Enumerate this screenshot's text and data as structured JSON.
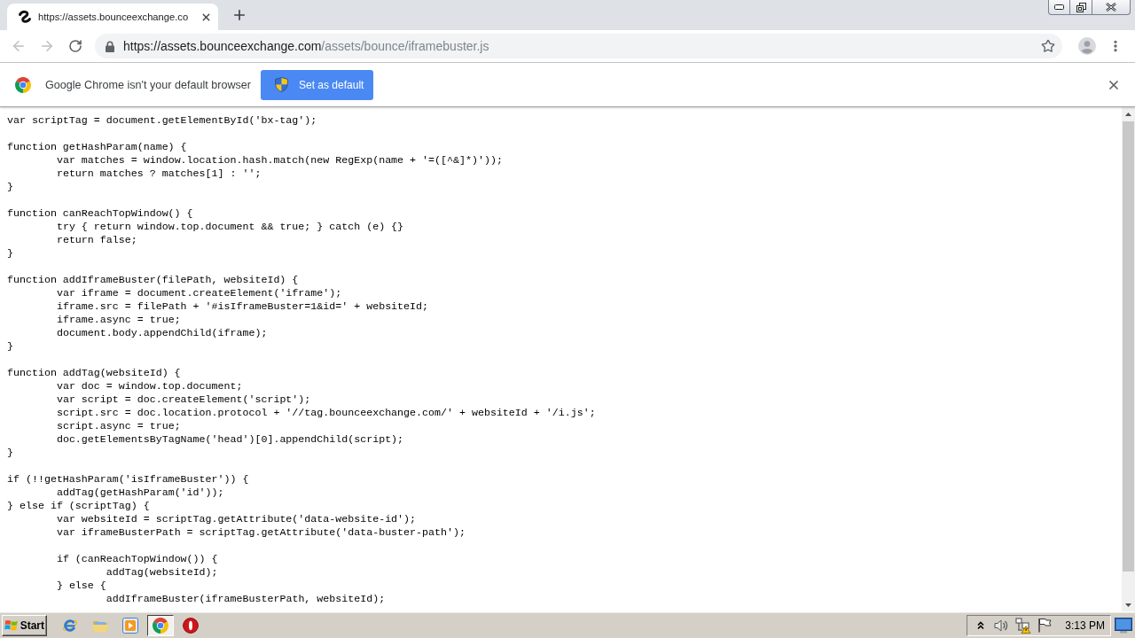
{
  "browser": {
    "tabs": [
      {
        "title": "https://assets.bounceexchange.co",
        "selected": true
      }
    ],
    "toolbar": {
      "back": {
        "disabled": true
      },
      "forward": {
        "disabled": true
      },
      "address": {
        "host": "https://assets.bounceexchange.com",
        "path": "/assets/bounce/iframebuster.js"
      }
    }
  },
  "infobar": {
    "message": "Google Chrome isn't your default browser",
    "button": "Set as default"
  },
  "code_blocks": [
    [
      "var scriptTag = document.getElementById('bx-tag');"
    ],
    [
      "function getHashParam(name) {",
      "\tvar matches = window.location.hash.match(new RegExp(name + '=([^&]*)'));",
      "\treturn matches ? matches[1] : '';",
      "}"
    ],
    [
      "function canReachTopWindow() {",
      "\ttry { return window.top.document && true; } catch (e) {}",
      "\treturn false;",
      "}"
    ],
    [
      "function addIframeBuster(filePath, websiteId) {",
      "\tvar iframe = document.createElement('iframe');",
      "\tiframe.src = filePath + '#isIframeBuster=1&id=' + websiteId;",
      "\tiframe.async = true;",
      "\tdocument.body.appendChild(iframe);",
      "}"
    ],
    [
      "function addTag(websiteId) {",
      "\tvar doc = window.top.document;",
      "\tvar script = doc.createElement('script');",
      "\tscript.src = doc.location.protocol + '//tag.bounceexchange.com/' + websiteId + '/i.js';",
      "\tscript.async = true;",
      "\tdoc.getElementsByTagName('head')[0].appendChild(script);",
      "}"
    ],
    [
      "if (!!getHashParam('isIframeBuster')) {",
      "\taddTag(getHashParam('id'));",
      "} else if (scriptTag) {",
      "\tvar websiteId = scriptTag.getAttribute('data-website-id');",
      "\tvar iframeBusterPath = scriptTag.getAttribute('data-buster-path');"
    ],
    [
      "\tif (canReachTopWindow()) {",
      "\t\taddTag(websiteId);",
      "\t} else {",
      "\t\taddIframeBuster(iframeBusterPath, websiteId);"
    ]
  ],
  "taskbar": {
    "start": "Start",
    "apps": [
      {
        "kind": "explorer",
        "selected": false
      },
      {
        "kind": "folder",
        "selected": false
      },
      {
        "kind": "player",
        "selected": false
      },
      {
        "kind": "chrome",
        "selected": true
      },
      {
        "kind": "stop",
        "selected": false
      }
    ],
    "clock": "3:13 PM"
  }
}
